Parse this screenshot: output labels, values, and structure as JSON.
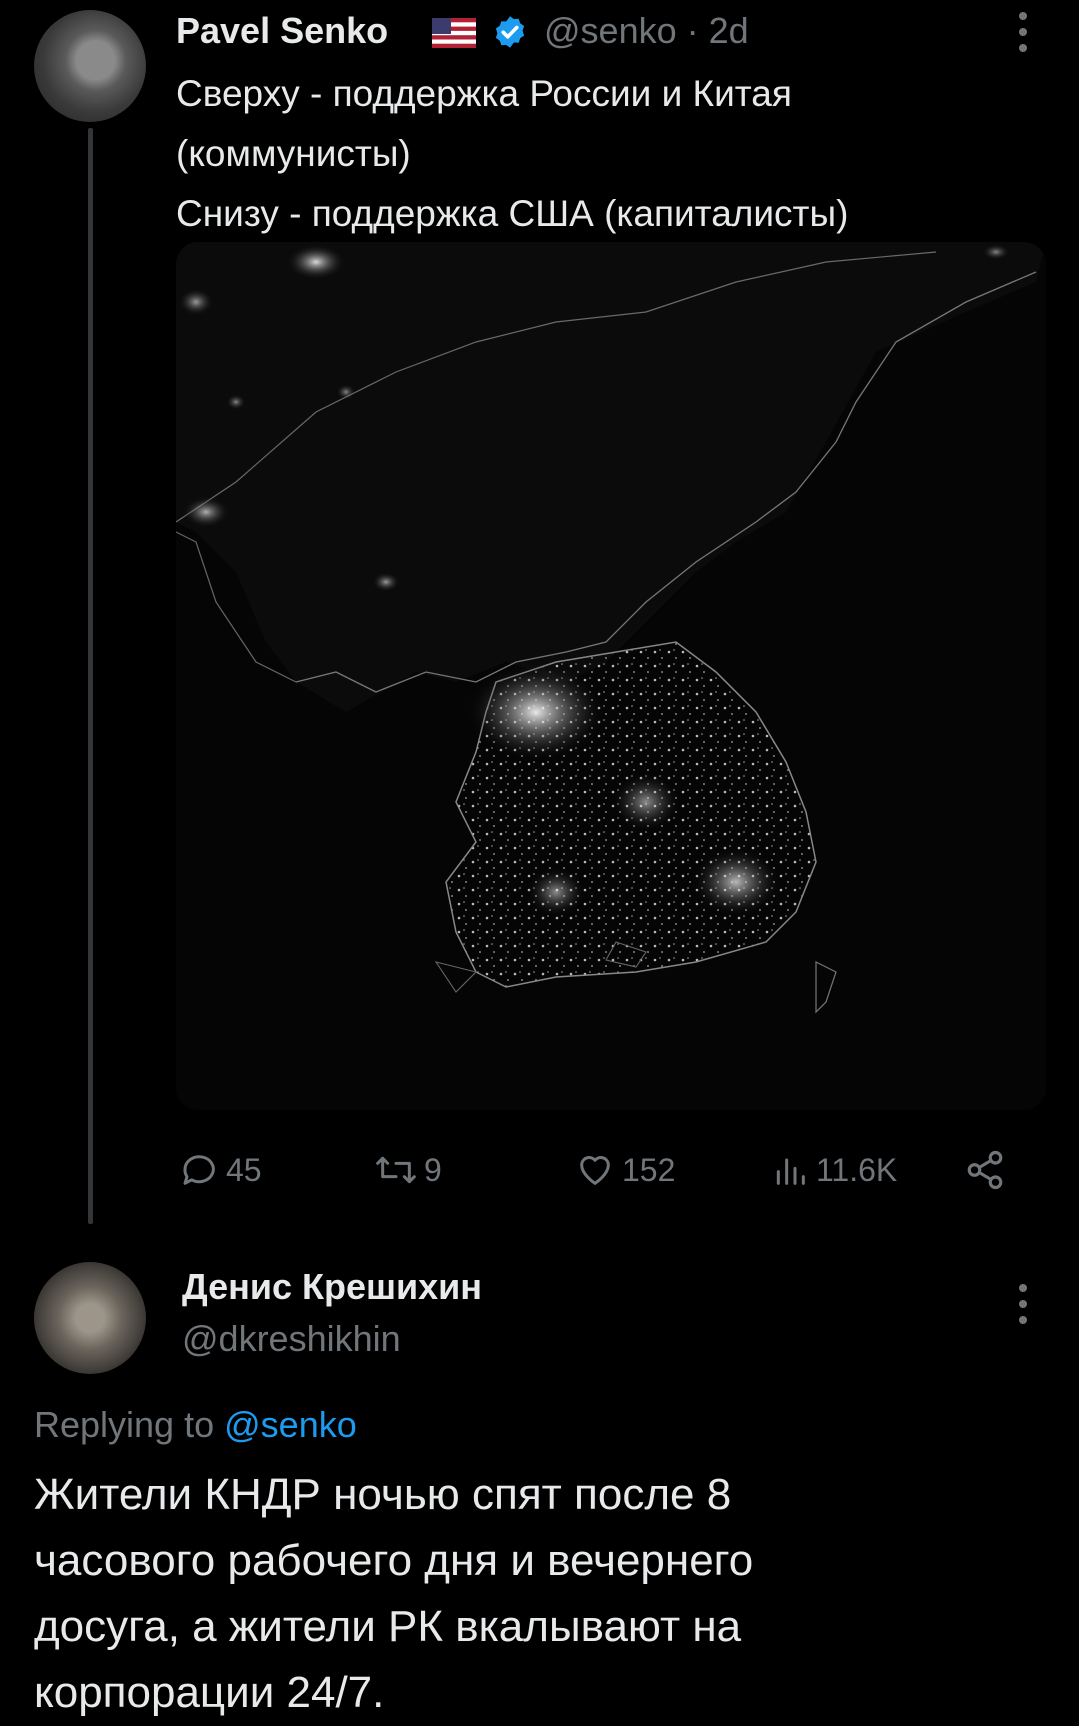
{
  "tweet": {
    "author_name": "Pavel Senko",
    "flag_icon": "us-flag-icon",
    "verified_icon": "verified-badge-icon",
    "verified_color": "#1d9bf0",
    "handle": "@senko",
    "time": "· 2d",
    "text_lines": [
      "Сверху - поддержка России и Китая",
      "(коммунисты)",
      "Снизу - поддержка США (капиталисты)"
    ],
    "media_description_icon": "korea-night-satellite-image",
    "actions": {
      "replies": "45",
      "retweets": "9",
      "likes": "152",
      "views": "11.6K"
    }
  },
  "reply": {
    "author_name": "Денис Крешихин",
    "handle": "@dkreshikhin",
    "replying_prefix": "Replying to",
    "replying_mention": "@senko",
    "text_lines": [
      "Жители КНДР ночью спят после 8",
      "часового рабочего дня и вечернего",
      "досуга, а жители РК вкалывают на",
      "корпорации 24/7."
    ]
  },
  "colors": {
    "background": "#000000",
    "text_primary": "#e7e9ea",
    "text_secondary": "#71767b",
    "accent": "#1d9bf0",
    "thread_line": "#333639"
  }
}
